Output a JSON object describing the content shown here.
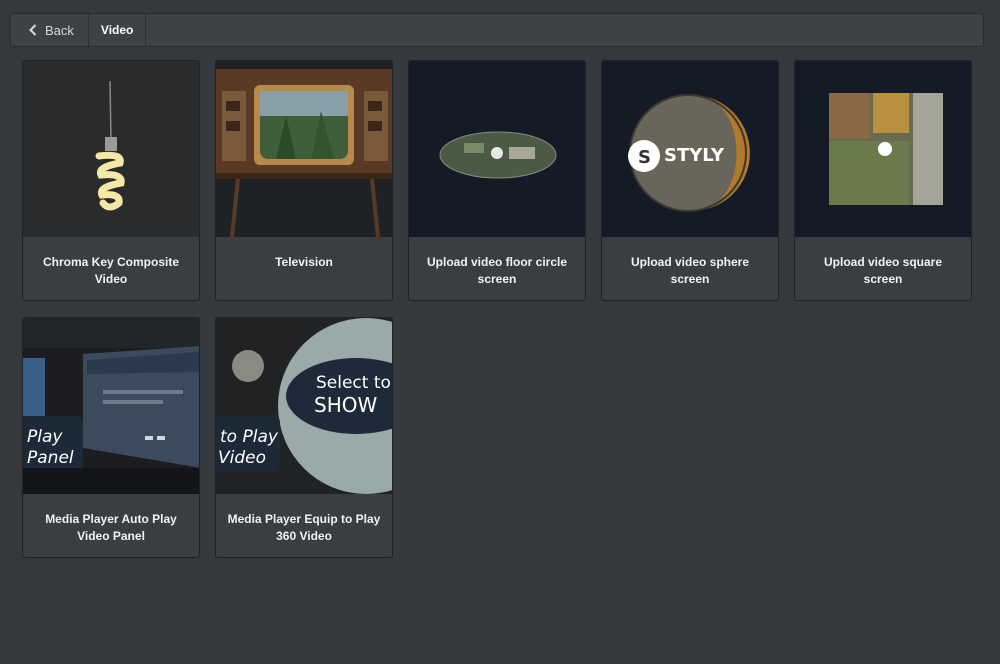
{
  "header": {
    "back_label": "Back",
    "breadcrumb": "Video"
  },
  "cards": [
    {
      "title": "Chroma Key Composite Video"
    },
    {
      "title": "Television"
    },
    {
      "title": "Upload video floor circle screen"
    },
    {
      "title": "Upload video sphere screen",
      "thumb_text": "STYLY"
    },
    {
      "title": "Upload video square screen"
    },
    {
      "title": "Media Player Auto Play Video Panel",
      "thumb_text_1": "Play",
      "thumb_text_2": "Panel"
    },
    {
      "title": "Media Player Equip to Play 360 Video",
      "thumb_text_1": "to Play",
      "thumb_text_2": "Video",
      "thumb_text_3": "Select to",
      "thumb_text_4": "SHOW"
    }
  ]
}
